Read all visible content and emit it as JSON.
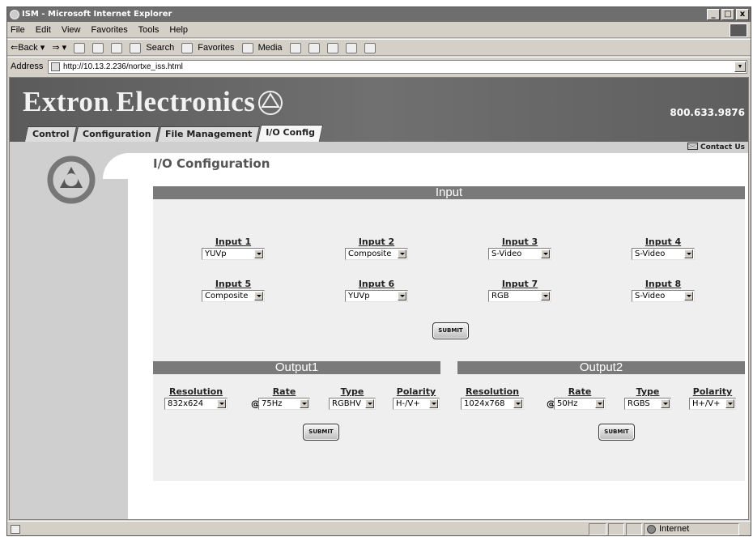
{
  "window": {
    "title": "ISM - Microsoft Internet Explorer",
    "buttons": [
      "_",
      "□",
      "x"
    ]
  },
  "menu": [
    "File",
    "Edit",
    "View",
    "Favorites",
    "Tools",
    "Help"
  ],
  "toolbar": {
    "back": "⇐Back ▾",
    "forward": "⇒ ▾",
    "search": "Search",
    "favorites": "Favorites",
    "media": "Media"
  },
  "address": {
    "label": "Address",
    "url": "http://10.13.2.236/nortxe_iss.html"
  },
  "banner": {
    "brand": "Extron",
    "brand2": "Electronics",
    "phone": "800.633.9876"
  },
  "tabs": [
    "Control",
    "Configuration",
    "File Management",
    "I/O Config"
  ],
  "contact": "Contact Us",
  "page": {
    "title": "I/O Configuration"
  },
  "input": {
    "header": "Input",
    "items": [
      {
        "label": "Input 1",
        "value": "YUVp"
      },
      {
        "label": "Input 2",
        "value": "Composite"
      },
      {
        "label": "Input 3",
        "value": "S-Video"
      },
      {
        "label": "Input 4",
        "value": "S-Video"
      },
      {
        "label": "Input 5",
        "value": "Composite"
      },
      {
        "label": "Input 6",
        "value": "YUVp"
      },
      {
        "label": "Input 7",
        "value": "RGB"
      },
      {
        "label": "Input 8",
        "value": "S-Video"
      }
    ],
    "submit": "SUBMIT"
  },
  "outputs": [
    {
      "header": "Output1",
      "resolution_label": "Resolution",
      "resolution": "832x624",
      "rate_label": "Rate",
      "at": "@",
      "rate": "75Hz",
      "type_label": "Type",
      "type": "RGBHV",
      "polarity_label": "Polarity",
      "polarity": "H-/V+",
      "submit": "SUBMIT"
    },
    {
      "header": "Output2",
      "resolution_label": "Resolution",
      "resolution": "1024x768",
      "rate_label": "Rate",
      "at": "@",
      "rate": "50Hz",
      "type_label": "Type",
      "type": "RGBS",
      "polarity_label": "Polarity",
      "polarity": "H+/V+",
      "submit": "SUBMIT"
    }
  ],
  "status": {
    "zone": "Internet"
  }
}
